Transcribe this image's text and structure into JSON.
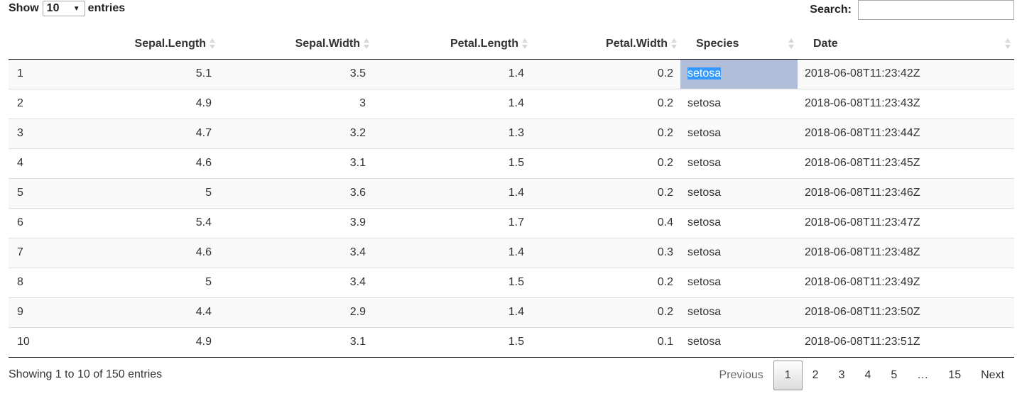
{
  "length_menu": {
    "show_label": "Show",
    "value": "10",
    "entries_label": "entries"
  },
  "search": {
    "label": "Search:",
    "value": ""
  },
  "columns": [
    "",
    "Sepal.Length",
    "Sepal.Width",
    "Petal.Length",
    "Petal.Width",
    "Species",
    "Date"
  ],
  "rows": [
    [
      "1",
      "5.1",
      "3.5",
      "1.4",
      "0.2",
      "setosa",
      "2018-06-08T11:23:42Z"
    ],
    [
      "2",
      "4.9",
      "3",
      "1.4",
      "0.2",
      "setosa",
      "2018-06-08T11:23:43Z"
    ],
    [
      "3",
      "4.7",
      "3.2",
      "1.3",
      "0.2",
      "setosa",
      "2018-06-08T11:23:44Z"
    ],
    [
      "4",
      "4.6",
      "3.1",
      "1.5",
      "0.2",
      "setosa",
      "2018-06-08T11:23:45Z"
    ],
    [
      "5",
      "5",
      "3.6",
      "1.4",
      "0.2",
      "setosa",
      "2018-06-08T11:23:46Z"
    ],
    [
      "6",
      "5.4",
      "3.9",
      "1.7",
      "0.4",
      "setosa",
      "2018-06-08T11:23:47Z"
    ],
    [
      "7",
      "4.6",
      "3.4",
      "1.4",
      "0.3",
      "setosa",
      "2018-06-08T11:23:48Z"
    ],
    [
      "8",
      "5",
      "3.4",
      "1.5",
      "0.2",
      "setosa",
      "2018-06-08T11:23:49Z"
    ],
    [
      "9",
      "4.4",
      "2.9",
      "1.4",
      "0.2",
      "setosa",
      "2018-06-08T11:23:50Z"
    ],
    [
      "10",
      "4.9",
      "3.1",
      "1.5",
      "0.1",
      "setosa",
      "2018-06-08T11:23:51Z"
    ]
  ],
  "info": "Showing 1 to 10 of 150 entries",
  "pagination": {
    "previous": "Previous",
    "pages": [
      "1",
      "2",
      "3",
      "4",
      "5"
    ],
    "ellipsis": "…",
    "last": "15",
    "next": "Next",
    "current": "1"
  },
  "colors": {
    "selected_cell": "#b0bed9",
    "text_highlight": "#3399ff"
  }
}
